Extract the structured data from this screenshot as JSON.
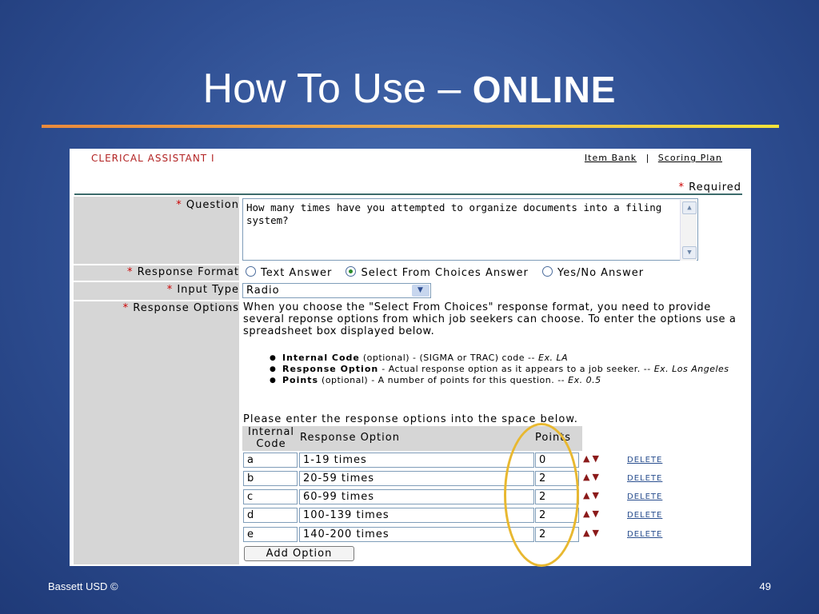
{
  "slide": {
    "title_main": "How To Use – ",
    "title_emph": "ONLINE",
    "footer_left": "Bassett USD ©",
    "page_number": "49"
  },
  "form": {
    "job_title": "CLERICAL ASSISTANT I",
    "links": {
      "item_bank": "Item Bank",
      "separator": "|",
      "scoring_plan": "Scoring Plan"
    },
    "required_note": {
      "star": "*",
      "text": "Required"
    },
    "question": {
      "label": "Question",
      "value": "How many times have you attempted to organize documents into a filing system?"
    },
    "response_format": {
      "label": "Response Format",
      "options": [
        "Text Answer",
        "Select From Choices Answer",
        "Yes/No Answer"
      ],
      "selected": "Select From Choices Answer"
    },
    "input_type": {
      "label": "Input Type",
      "value": "Radio"
    },
    "response_options": {
      "label": "Response Options",
      "help": "When you choose the \"Select From Choices\" response format, you need to provide several reponse options from which job seekers can choose. To enter the options use a spreadsheet box displayed below.",
      "bullets": [
        {
          "term": "Internal Code",
          "desc": " (optional) - (SIGMA or TRAC) code -- ",
          "example": "Ex. LA"
        },
        {
          "term": "Response Option",
          "desc": " - Actual response option as it appears to a job seeker. -- ",
          "example": "Ex. Los Angeles"
        },
        {
          "term": "Points",
          "desc": " (optional) - A number of points for this question. -- ",
          "example": "Ex. 0.5"
        }
      ],
      "enter_text": "Please enter the response options into the space below.",
      "columns": {
        "code_line1": "Internal",
        "code_line2": "Code",
        "option": "Response Option",
        "points": "Points"
      },
      "rows": [
        {
          "code": "a",
          "option": "1-19 times",
          "points": "0"
        },
        {
          "code": "b",
          "option": "20-59 times",
          "points": "2"
        },
        {
          "code": "c",
          "option": "60-99 times",
          "points": "2"
        },
        {
          "code": "d",
          "option": "100-139 times",
          "points": "2"
        },
        {
          "code": "e",
          "option": "140-200 times",
          "points": "2"
        }
      ],
      "delete_label": "DELETE",
      "add_button": "Add Option"
    }
  },
  "colors": {
    "highlight_oval": "#e8b830",
    "job_title": "#b22222",
    "required_star": "#cc0000"
  }
}
